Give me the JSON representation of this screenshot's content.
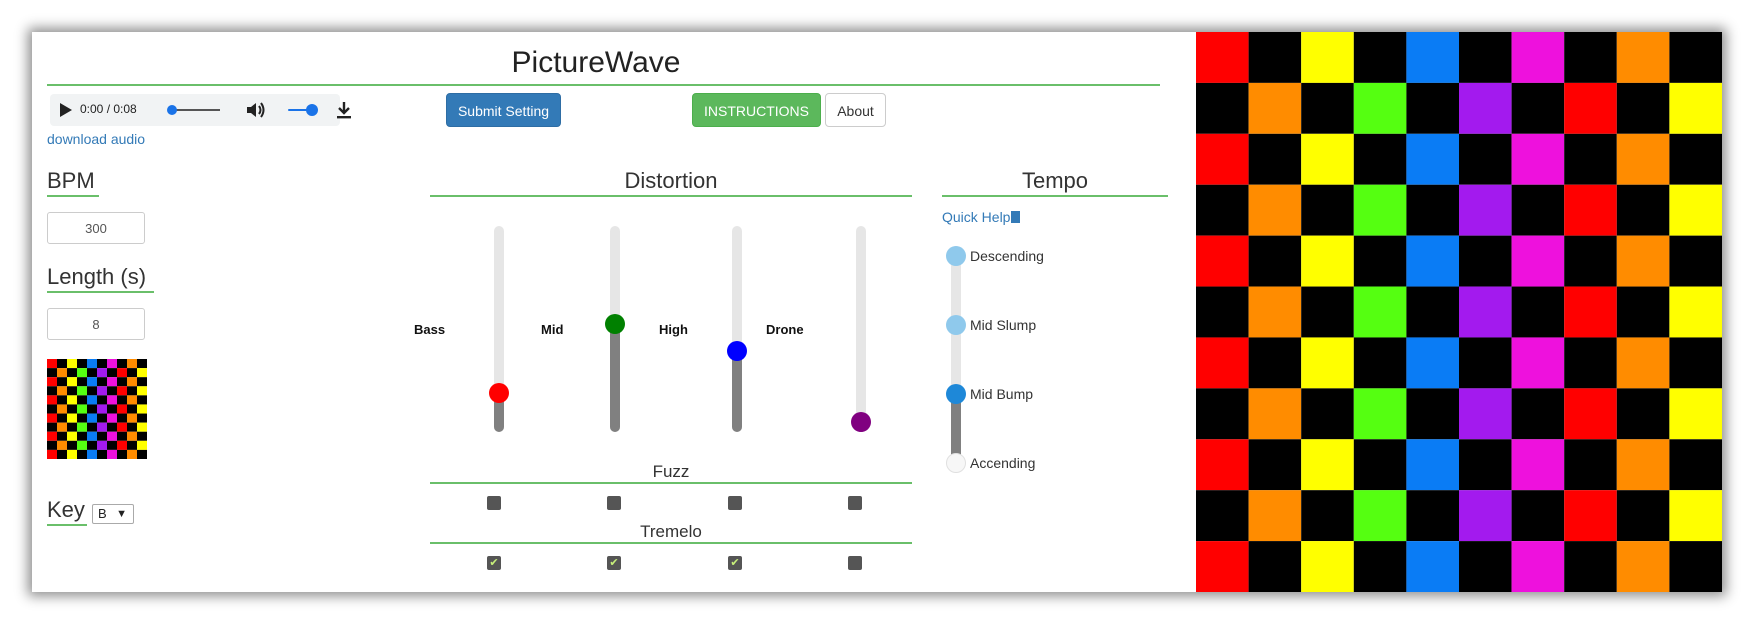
{
  "app": {
    "title": "PictureWave"
  },
  "audio": {
    "time": "0:00 / 0:08",
    "download_label": "download audio"
  },
  "buttons": {
    "submit": "Submit Setting",
    "instructions": "INSTRUCTIONS",
    "about": "About"
  },
  "bpm": {
    "label": "BPM",
    "value": "300"
  },
  "length": {
    "label": "Length (s)",
    "value": "8"
  },
  "key": {
    "label": "Key",
    "selected": "B"
  },
  "distortion": {
    "title": "Distortion",
    "sliders": [
      {
        "label": "Bass",
        "level": 0.15,
        "color": "#ff0000"
      },
      {
        "label": "Mid",
        "level": 0.5,
        "color": "#008000"
      },
      {
        "label": "High",
        "level": 0.36,
        "color": "#0000ff"
      },
      {
        "label": "Drone",
        "level": 0.0,
        "color": "#800080"
      }
    ],
    "fuzz": {
      "title": "Fuzz",
      "checked": [
        false,
        false,
        false,
        false
      ]
    },
    "tremelo": {
      "title": "Tremelo",
      "checked": [
        true,
        true,
        true,
        false
      ]
    }
  },
  "tempo": {
    "title": "Tempo",
    "help": "Quick Help",
    "options": [
      "Descending",
      "Mid Slump",
      "Mid Bump",
      "Accending"
    ],
    "selected": "Mid Bump"
  },
  "palette": {
    "accent_green": "#6abf6a",
    "link": "#337ab7",
    "grid_colors": [
      "#ff0000",
      "#ff8c00",
      "#ffff00",
      "#55ff11",
      "#0a7cf5",
      "#a31aee",
      "#ee11dd",
      "#000000"
    ]
  }
}
